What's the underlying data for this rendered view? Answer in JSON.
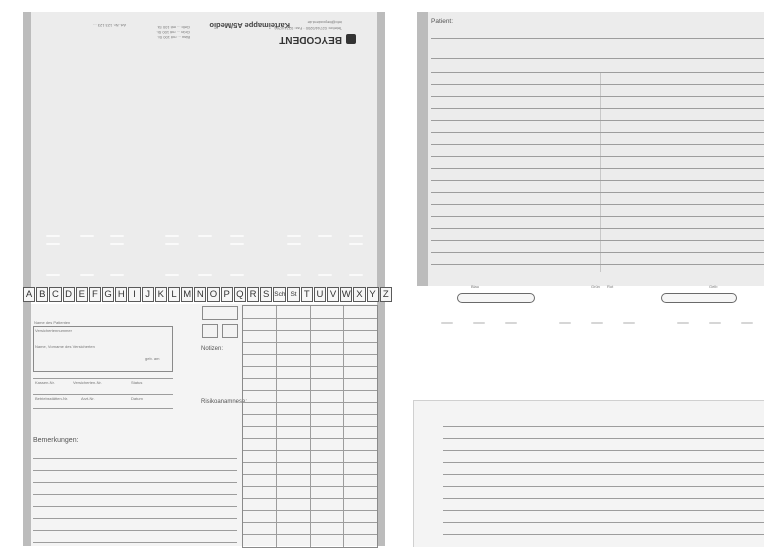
{
  "left_card": {
    "brand": "BEYCODENT",
    "product_title": "Karteimappe A5/Medio",
    "header_fine_print": [
      "Telefon: 02744/9200 · Fax: 02744/766",
      "info@beycodent.de",
      "Art.-Nr. 123 123 ...",
      "Blau  ... mit 100 St.",
      "Grün  ... mit 100 St.",
      "Gelb  ... mit 100 St."
    ],
    "tabs": [
      "A",
      "B",
      "C",
      "D",
      "E",
      "F",
      "G",
      "H",
      "I",
      "J",
      "K",
      "L",
      "M",
      "N",
      "O",
      "P",
      "Q",
      "R",
      "S",
      "Sch",
      "St",
      "T",
      "U",
      "V",
      "W",
      "X",
      "Y",
      "Z"
    ],
    "patient_header": "Name des Patienten",
    "field_labels": [
      "Versichertennummer",
      "Name, Vorname des Versicherten",
      "geb. am",
      "Kassen-Nr.",
      "Versicherten-Nr.",
      "Status",
      "Betriebsstätten-Nr.",
      "Arzt-Nr.",
      "Datum"
    ],
    "notes_label": "Notizen:",
    "risk_label": "Risikoanamnese:",
    "remarks_label": "Bemerkungen:"
  },
  "right_card": {
    "patient_label": "Patient:",
    "slot_labels": [
      "Blau",
      "Grün",
      "Rot",
      "Gelb"
    ]
  },
  "colors": {
    "paper": "#ececec",
    "margin_strip": "#bcbcbc",
    "rule": "#9d9d9d"
  }
}
